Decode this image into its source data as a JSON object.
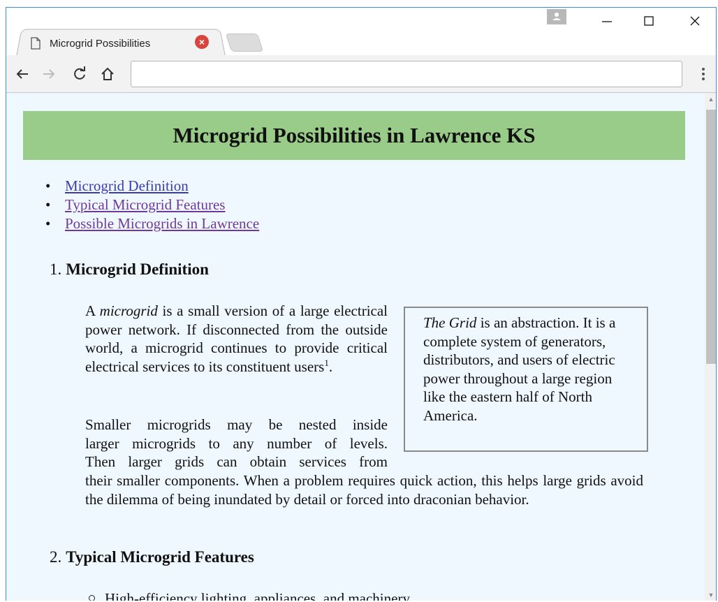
{
  "browser": {
    "tab_title": "Microgrid Possibilities",
    "address_value": "",
    "controls": {
      "back": "←",
      "forward": "→",
      "reload": "C"
    }
  },
  "page": {
    "heading": "Microgrid Possibilities in Lawrence KS",
    "toc": [
      {
        "label": "Microgrid Definition"
      },
      {
        "label": "Typical Microgrid Features"
      },
      {
        "label": "Possible Microgrids in Lawrence"
      }
    ],
    "section1": {
      "number": "1.",
      "title": "Microgrid Definition",
      "para1_before": "A ",
      "para1_em": "microgrid",
      "para1_after": " is a small version of a large electrical power network. If disconnected from the outside world, a microgrid continues to provide critical electrical services to its constituent users",
      "para1_footnote": "1",
      "para1_end": ".",
      "para2_lines": [
        "Smaller microgrids may be nested inside",
        "larger microgrids to any number of levels.",
        "Then larger grids can obtain services from"
      ],
      "para2_rest": "their smaller components. When a problem requires quick action, this helps large grids avoid the dilemma of being inundated by detail or forced into draconian behavior.",
      "callout_em": "The Grid",
      "callout_text": " is an abstraction. It is a complete system of generators, distributors, and users of electric power throughout a large region like the eastern half of North America."
    },
    "section2": {
      "number": "2.",
      "title": "Typical Microgrid Features",
      "items": [
        "High-efficiency lighting, appliances, and machinery."
      ]
    }
  }
}
